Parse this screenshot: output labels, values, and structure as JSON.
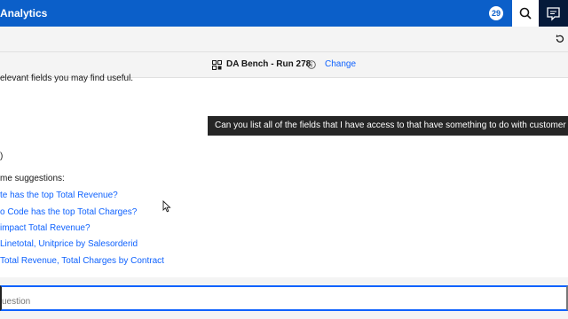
{
  "header": {
    "app_title": "Analytics",
    "notification_count": "29"
  },
  "dataset": {
    "name": "DA Bench - Run 278",
    "change_label": "Change"
  },
  "conversation": {
    "partial_text": "elevant fields you may find useful.",
    "paren_text": ")",
    "suggestions_heading": "me suggestions:",
    "suggestions": [
      "te has the top Total Revenue?",
      "o Code has the top Total Charges?",
      "impact Total Revenue?",
      "Linetotal, Unitprice by Salesorderid",
      "Total Revenue, Total Charges by Contract"
    ],
    "tooltip_text": "Can you list all of the fields that I have access to that have something to do with customer demo"
  },
  "input": {
    "placeholder": "uestion"
  },
  "colors": {
    "header_bg": "#0b5fc9",
    "link": "#0f62fe",
    "tooltip_bg": "#262626"
  }
}
